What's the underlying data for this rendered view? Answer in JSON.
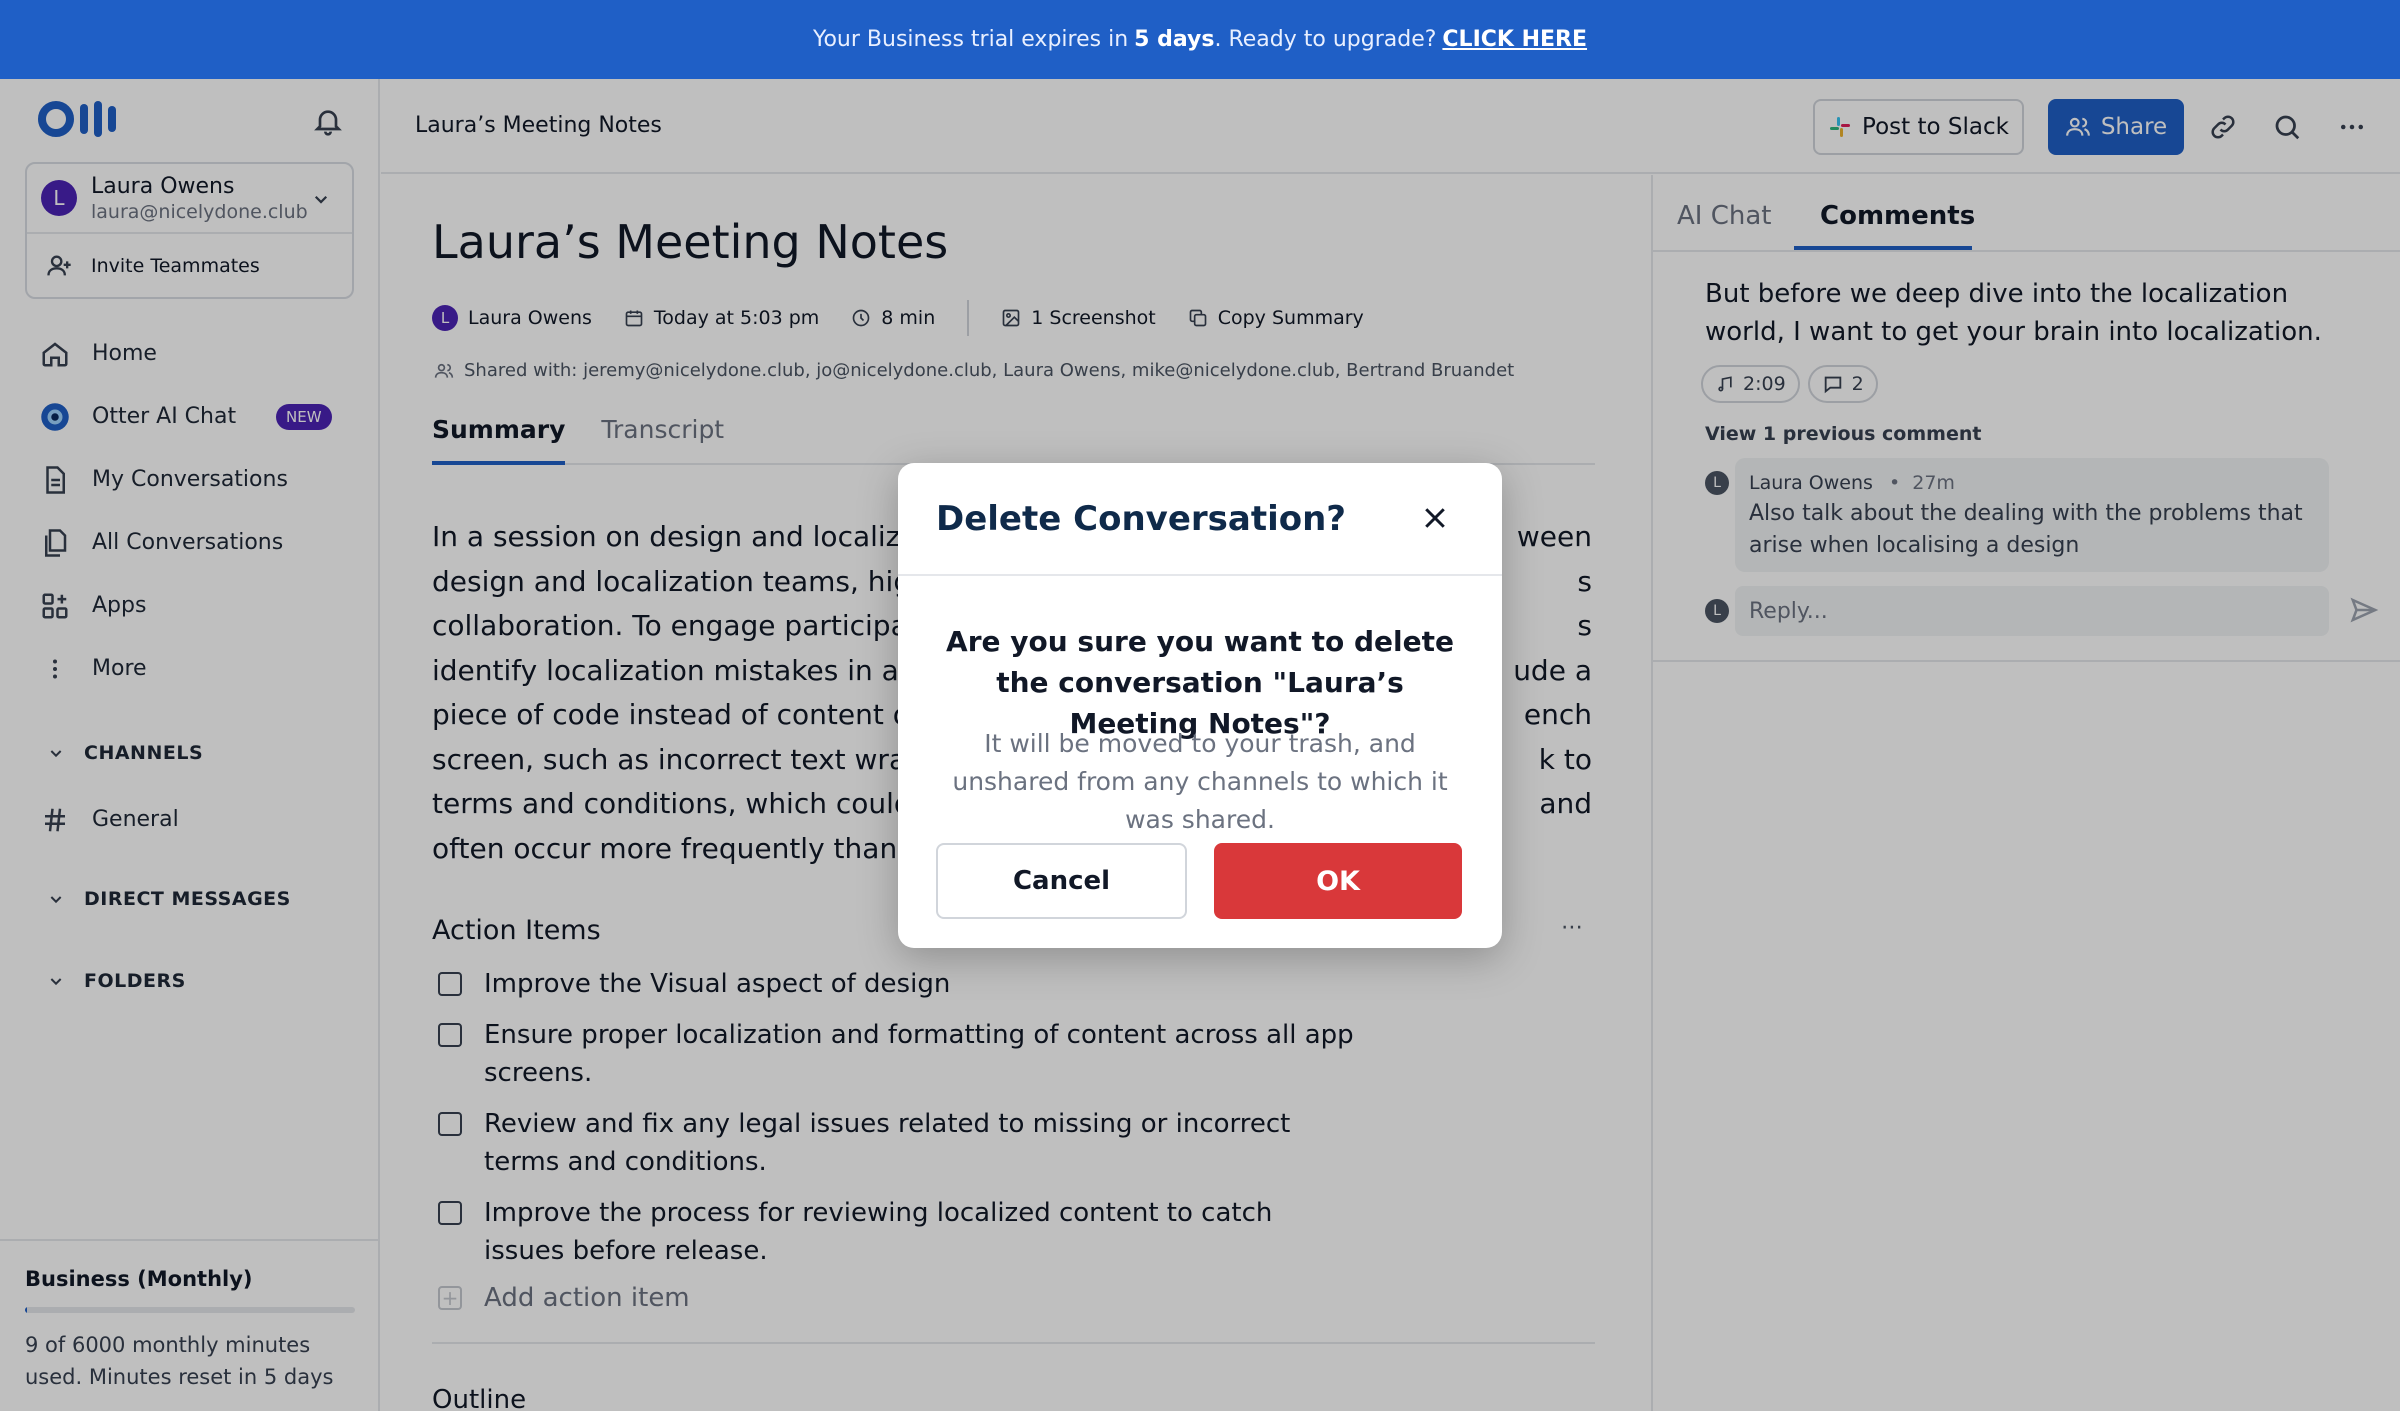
{
  "banner": {
    "prefix": "Your Business trial expires in",
    "days": "5 days",
    "middle": ". Ready to upgrade?",
    "link": "CLICK HERE"
  },
  "sidebar": {
    "account": {
      "initial": "L",
      "name": "Laura Owens",
      "email": "laura@nicelydone.club",
      "invite": "Invite Teammates"
    },
    "items": [
      {
        "label": "Home",
        "icon": "home-icon"
      },
      {
        "label": "Otter AI Chat",
        "icon": "otter-chat-icon",
        "badge": "NEW"
      },
      {
        "label": "My Conversations",
        "icon": "document-icon"
      },
      {
        "label": "All Conversations",
        "icon": "documents-icon"
      },
      {
        "label": "Apps",
        "icon": "apps-icon"
      },
      {
        "label": "More",
        "icon": "more-vertical-icon"
      }
    ],
    "sections": {
      "channels": "CHANNELS",
      "general": "General",
      "direct_messages": "DIRECT MESSAGES",
      "folders": "FOLDERS"
    },
    "plan": {
      "title": "Business (Monthly)",
      "usage": "9 of 6000 monthly minutes used. Minutes reset in 5 days",
      "used_fraction": 0.0015
    }
  },
  "header": {
    "title": "Laura’s Meeting Notes",
    "post_to_slack": "Post to Slack",
    "share": "Share"
  },
  "doc": {
    "title": "Laura’s Meeting Notes",
    "meta": {
      "author_initial": "L",
      "author": "Laura Owens",
      "date": "Today at 5:03 pm",
      "duration": "8 min",
      "screenshots": "1 Screenshot",
      "copy_summary": "Copy Summary"
    },
    "shared_with": "Shared with: jeremy@nicelydone.club, jo@nicelydone.club, Laura Owens, mike@nicelydone.club, Bertrand Bruandet",
    "tabs": [
      "Summary",
      "Transcript"
    ],
    "summary_lines": [
      "In a session on design and localizat",
      "design and localization teams, high",
      "collaboration. To engage participar",
      "identify localization mistakes in a D",
      "piece of code instead of content on",
      "screen, such as incorrect text wrapp",
      "terms and conditions, which could b",
      "often occur more frequently than ex"
    ],
    "summary_right": [
      "ween",
      "s",
      "s",
      "ude a",
      "ench",
      "k to",
      "and",
      ""
    ],
    "action_items_title": "Action Items",
    "action_items": [
      "Improve the Visual aspect of design",
      "Ensure proper localization and formatting of content across all app screens.",
      "Review and fix any legal issues related to missing or incorrect terms and conditions.",
      "Improve the process for reviewing localized content to catch issues before release."
    ],
    "add_action": "Add action item",
    "outline": "Outline"
  },
  "right_panel": {
    "tabs": [
      "AI Chat",
      "Comments"
    ],
    "quote": "But before we deep dive into the localization world, I want to get your brain into localization.",
    "chip_time": "2:09",
    "chip_comments": "2",
    "view_previous": "View 1 previous comment",
    "comment": {
      "initial": "L",
      "author": "Laura Owens",
      "time": "27m",
      "body": "Also talk about the dealing with the problems that arise when localising a design"
    },
    "reply_placeholder": "Reply..."
  },
  "modal": {
    "title": "Delete Conversation?",
    "question": "Are you sure you want to delete the conversation \"Laura’s Meeting Notes\"?",
    "description": "It will be moved to your trash, and unshared from any channels to which it was shared.",
    "cancel": "Cancel",
    "ok": "OK"
  },
  "colors": {
    "brand": "#1f5fc6",
    "avatar": "#4b23b5",
    "danger": "#d9383a"
  }
}
